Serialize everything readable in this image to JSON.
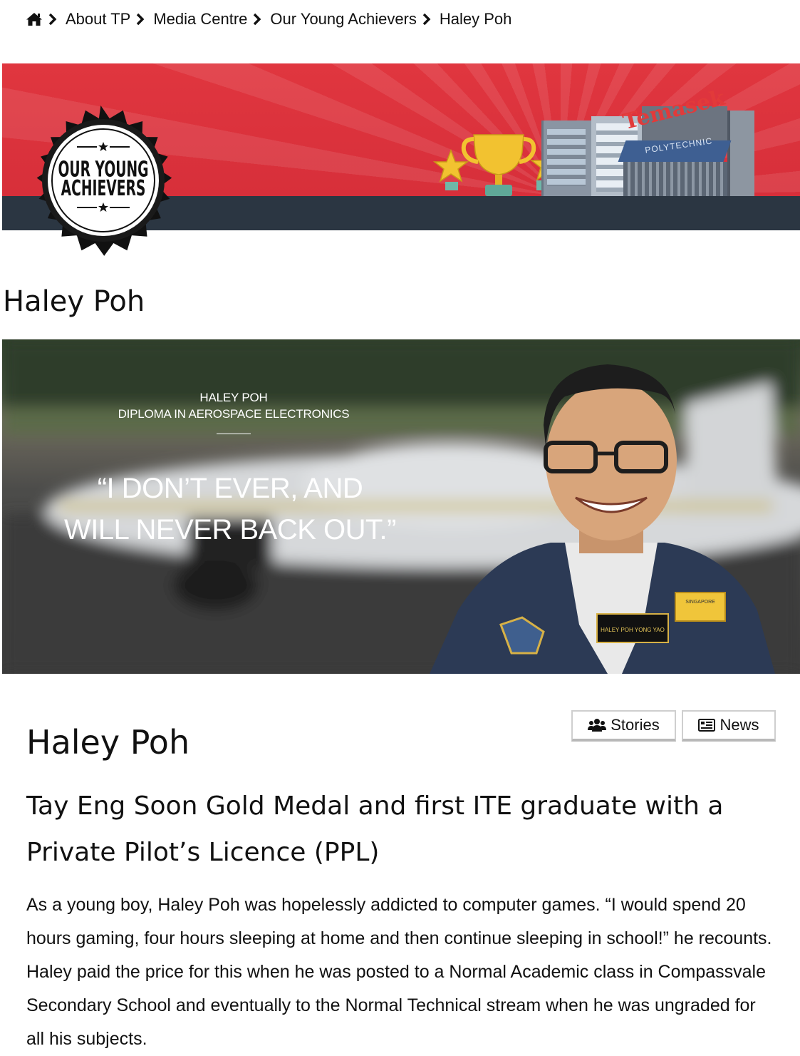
{
  "breadcrumb": {
    "home_icon": "home-icon",
    "separator_icon": "chevron-right-icon",
    "items": [
      "About TP",
      "Media Centre",
      "Our Young Achievers",
      "Haley Poh"
    ]
  },
  "banner": {
    "badge_line1": "OUR YOUNG",
    "badge_line2": "ACHIEVERS",
    "building_sign": "Temasek",
    "building_sub": "POLYTECHNIC",
    "colors": {
      "red": "#d72f3a",
      "dark": "#2b3642",
      "gold": "#f2c230"
    }
  },
  "page_title": "Haley Poh",
  "hero": {
    "name": "HALEY POH",
    "diploma": "DIPLOMA IN AEROSPACE ELECTRONICS",
    "quote_line1": "“I DON’T EVER, AND",
    "quote_line2": "WILL NEVER BACK OUT.”",
    "name_tag": "HALEY POH YONG YAO",
    "club_patch": "SINGAPORE"
  },
  "buttons": {
    "stories": {
      "label": "Stories",
      "icon": "users-icon"
    },
    "news": {
      "label": "News",
      "icon": "newspaper-icon"
    }
  },
  "profile": {
    "name": "Haley Poh",
    "subtitle": "Tay Eng Soon Gold Medal and first ITE graduate with a Private Pilot’s Licence (PPL)",
    "body": "As a young boy, Haley Poh was hopelessly addicted to computer games. “I would spend 20 hours gaming, four hours sleeping at home and then continue sleeping in school!” he recounts. Haley paid the price for this when he was posted to a Normal Academic class in Compassvale Secondary School and eventually to the Normal Technical stream when he was ungraded for all his subjects."
  }
}
